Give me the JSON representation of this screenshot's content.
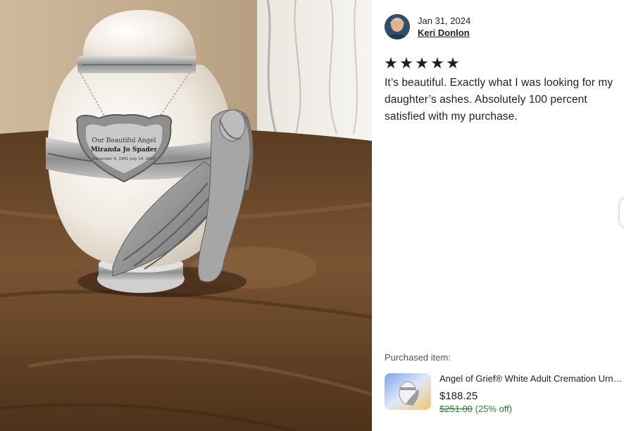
{
  "review": {
    "date": "Jan 31, 2024",
    "reviewer_name": "Keri Donlon",
    "rating": 5,
    "stars": [
      "★",
      "★",
      "★",
      "★",
      "★"
    ],
    "text": "It’s beautiful. Exactly what I was looking for my daughter’s ashes. Absolutely 100 percent satisfied with my purchase."
  },
  "photo": {
    "engraving": [
      "Our Beautiful Angel",
      "Miranda Jo Spader",
      "December 4, 1991-July 14, 2023"
    ]
  },
  "purchased": {
    "label": "Purchased item:",
    "title": "Angel of Grief® White Adult Cremation Urn for Human Ashes",
    "price": "$188.25",
    "original_price": "$251.00",
    "discount": "(25% off)"
  },
  "icons": {
    "star": "star-icon",
    "next": "next-arrow-button"
  }
}
